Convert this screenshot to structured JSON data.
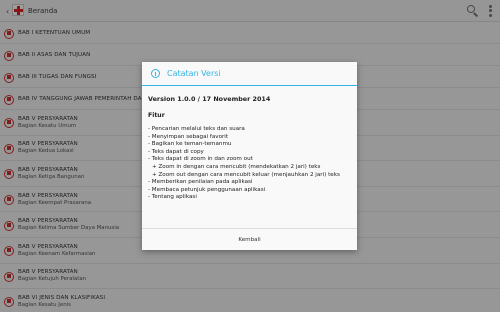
{
  "actionbar": {
    "title": "Beranda"
  },
  "list": [
    {
      "title": "BAB I KETENTUAN UMUM",
      "sub": ""
    },
    {
      "title": "BAB II ASAS DAN TUJUAN",
      "sub": ""
    },
    {
      "title": "BAB III TUGAS DAN FUNGSI",
      "sub": ""
    },
    {
      "title": "BAB IV TANGGUNG JAWAB PEMERINTAH DAN PEMERINTAH DAERAH",
      "sub": ""
    },
    {
      "title": "BAB V PERSYARATAN",
      "sub": "Bagian Kesatu Umum"
    },
    {
      "title": "BAB V PERSYARATAN",
      "sub": "Bagian Kedua Lokasi"
    },
    {
      "title": "BAB V PERSYARATAN",
      "sub": "Bagian Ketiga Bangunan"
    },
    {
      "title": "BAB V PERSYARATAN",
      "sub": "Bagian Keempat Prasarana"
    },
    {
      "title": "BAB V PERSYARATAN",
      "sub": "Bagian Kelima Sumber Daya Manusia"
    },
    {
      "title": "BAB V PERSYARATAN",
      "sub": "Bagian Keenam Kefarmasian"
    },
    {
      "title": "BAB V PERSYARATAN",
      "sub": "Bagian Ketujuh Peralatan"
    },
    {
      "title": "BAB VI JENIS DAN KLASIFIKASI",
      "sub": "Bagian Kesatu Jenis"
    }
  ],
  "dialog": {
    "title": "Catatan Versi",
    "version": "Version 1.0.0 / 17 November 2014",
    "features_heading": "Fitur",
    "features": [
      "- Pencarian melalui teks dan suara",
      "- Menyimpan sebagai favorit",
      "- Bagikan ke teman-temanmu",
      "- Teks dapat di copy",
      "- Teks dapat di zoom in dan zoom out",
      "  + Zoom in dengan cara mencubit (mendekatkan 2 jari) teks",
      "  + Zoom out dengan cara mencubit keluar (menjauhkan 2 jari) teks",
      "- Memberikan penilaian pada aplikasi",
      "- Membaca petunjuk penggunaan aplikasi",
      "- Tentang aplikasi"
    ],
    "close_label": "Kembali"
  },
  "colors": {
    "accent": "#33b5e5",
    "brand_red": "#d22222"
  },
  "icons": [
    "app-logo-icon",
    "search-icon",
    "overflow-menu-icon",
    "info-icon",
    "list-item-icon"
  ]
}
